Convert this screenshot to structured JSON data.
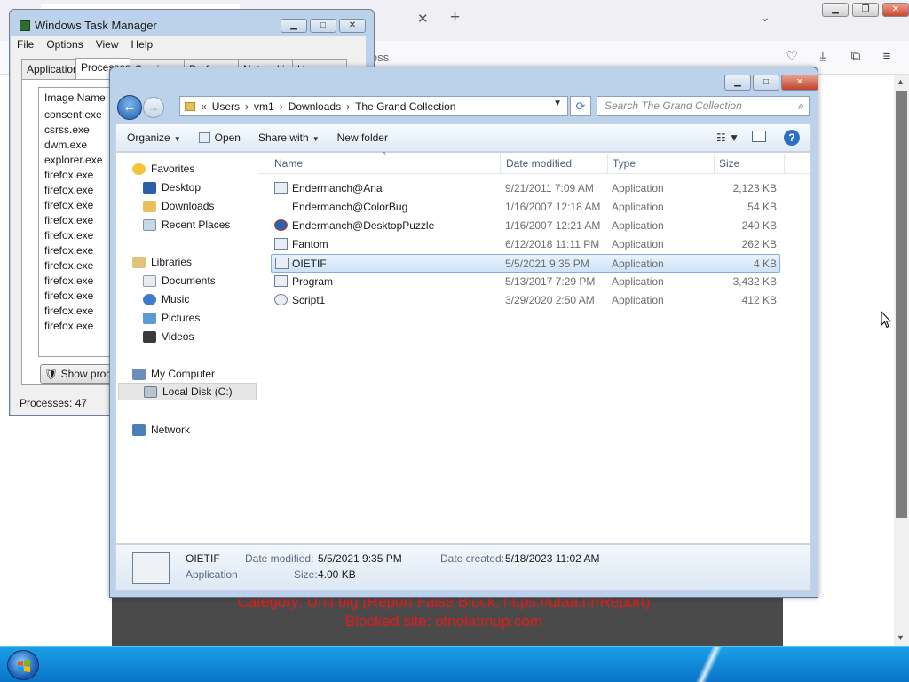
{
  "browser": {
    "url_fragment": "ess",
    "warning_line1": "Category: Unit big (Report False Block: https://ufaa.hr/Report)",
    "warning_line2": "Blocked site: otnolatmup.com",
    "icons": [
      "close-tab-icon",
      "new-tab-icon",
      "tab-list-icon",
      "pocket-icon",
      "download-icon",
      "extensions-icon",
      "menu-icon"
    ]
  },
  "taskmgr": {
    "title": "Windows Task Manager",
    "menu": [
      "File",
      "Options",
      "View",
      "Help"
    ],
    "tabs": [
      "Applications",
      "Processes",
      "Services",
      "Performance",
      "Networking",
      "Users"
    ],
    "active_tab": "Processes",
    "column_header": "Image Name",
    "processes": [
      "consent.exe",
      "csrss.exe",
      "dwm.exe",
      "explorer.exe",
      "firefox.exe",
      "firefox.exe",
      "firefox.exe",
      "firefox.exe",
      "firefox.exe",
      "firefox.exe",
      "firefox.exe",
      "firefox.exe",
      "firefox.exe",
      "firefox.exe",
      "firefox.exe"
    ],
    "show_button": "Show processes from all users",
    "status": "Processes: 47"
  },
  "explorer": {
    "breadcrumb": [
      "Users",
      "vm1",
      "Downloads",
      "The Grand Collection"
    ],
    "breadcrumb_prefix": "«",
    "search_placeholder": "Search The Grand Collection",
    "commands": {
      "organize": "Organize",
      "open": "Open",
      "share": "Share with",
      "newfolder": "New folder"
    },
    "nav": {
      "favorites": "Favorites",
      "desktop": "Desktop",
      "downloads": "Downloads",
      "recent": "Recent Places",
      "libraries": "Libraries",
      "documents": "Documents",
      "music": "Music",
      "pictures": "Pictures",
      "videos": "Videos",
      "computer": "My Computer",
      "localdisk": "Local Disk (C:)",
      "network": "Network"
    },
    "columns": {
      "name": "Name",
      "date": "Date modified",
      "type": "Type",
      "size": "Size"
    },
    "files": [
      {
        "name": "Endermanch@Ana",
        "date": "9/21/2011 7:09 AM",
        "type": "Application",
        "size": "2,123 KB"
      },
      {
        "name": "Endermanch@ColorBug",
        "date": "1/16/2007 12:18 AM",
        "type": "Application",
        "size": "54 KB"
      },
      {
        "name": "Endermanch@DesktopPuzzle",
        "date": "1/16/2007 12:21 AM",
        "type": "Application",
        "size": "240 KB"
      },
      {
        "name": "Fantom",
        "date": "6/12/2018 11:11 PM",
        "type": "Application",
        "size": "262 KB"
      },
      {
        "name": "OIETIF",
        "date": "5/5/2021 9:35 PM",
        "type": "Application",
        "size": "4 KB"
      },
      {
        "name": "Program",
        "date": "5/13/2017 7:29 PM",
        "type": "Application",
        "size": "3,432 KB"
      },
      {
        "name": "Script1",
        "date": "3/29/2020 2:50 AM",
        "type": "Application",
        "size": "412 KB"
      }
    ],
    "selected_file": "OIETIF",
    "details": {
      "name": "OIETIF",
      "type": "Application",
      "modified_label": "Date modified:",
      "modified": "5/5/2021 9:35 PM",
      "size_label": "Size:",
      "size": "4.00 KB",
      "created_label": "Date created:",
      "created": "5/18/2023 11:02 AM"
    }
  }
}
